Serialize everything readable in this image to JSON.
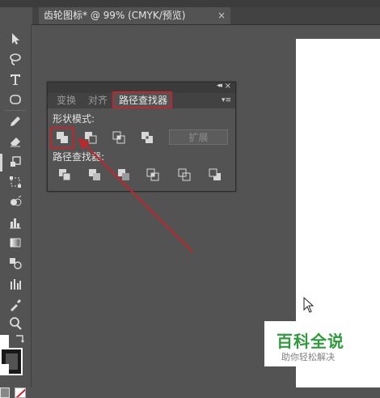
{
  "document": {
    "tab_title": "齿轮图标* @ 99% (CMYK/预览)",
    "close_glyph": "×"
  },
  "toolbar": {
    "tools": [
      "selection-icon",
      "lasso-icon",
      "type-icon",
      "ellipse-icon",
      "pencil-icon",
      "eraser-icon",
      "scale-icon",
      "free-transform-icon",
      "shape-builder-icon",
      "bar-graph-icon",
      "gradient-icon",
      "blend-icon",
      "column-graph-icon",
      "eyedropper-icon",
      "zoom-icon",
      "swap-colors-icon",
      "fill-swatch-icon",
      "stroke-swatch-icon",
      "none-swatch-icon"
    ]
  },
  "panel": {
    "tabs": [
      "变换",
      "对齐",
      "路径查找器"
    ],
    "active_tab": "路径查找器",
    "collapse_glyph": "◂◂",
    "close_glyph": "×",
    "menu_glyph": "▾≡",
    "shape_modes_label": "形状模式:",
    "shape_mode_buttons": [
      "unite-icon",
      "minus-front-icon",
      "intersect-icon",
      "exclude-icon"
    ],
    "expand_label": "扩展",
    "pathfinders_label": "路径查找器:",
    "pathfinder_buttons": [
      "divide-icon",
      "trim-icon",
      "merge-icon",
      "crop-icon",
      "outline-icon",
      "minus-back-icon"
    ]
  },
  "annotation": {
    "color": "#c0272d"
  },
  "watermark": {
    "title": "百科全说",
    "subtitle": "助你轻松解决",
    "color": "#2e9a3c"
  }
}
